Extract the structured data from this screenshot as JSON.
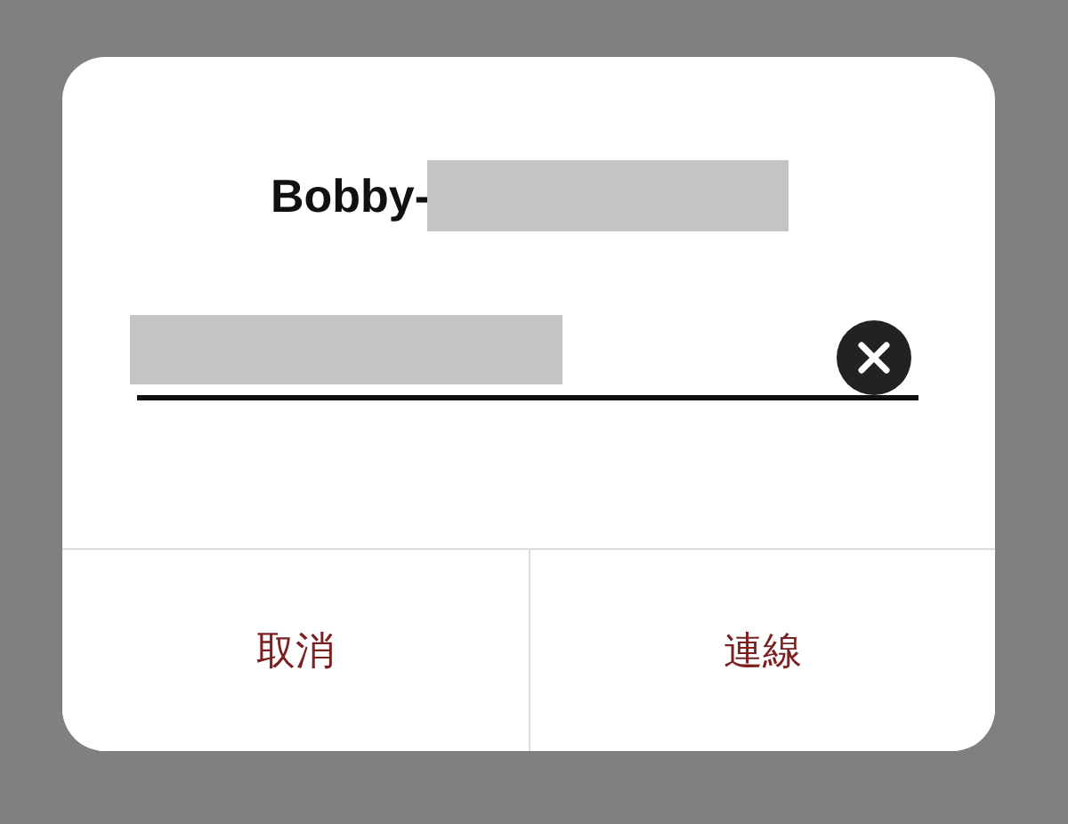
{
  "dialog": {
    "title": "Bobby-",
    "title_redacted": true,
    "field": {
      "value_redacted": true,
      "clear_button": true
    },
    "buttons": [
      {
        "label": "取消"
      },
      {
        "label": "連線"
      }
    ]
  }
}
